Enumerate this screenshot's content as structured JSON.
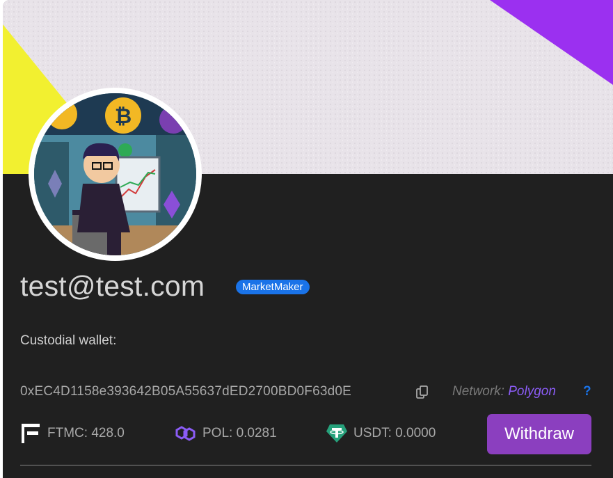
{
  "profile": {
    "username": "test@test.com",
    "role_badge": "MarketMaker",
    "avatar_icon": "pixel-art-trader-avatar"
  },
  "wallet": {
    "label": "Custodial wallet:",
    "address": "0xEC4D1158e393642B05A55637dED2700BD0F63d0E",
    "network_label": "Network:",
    "network_value": "Polygon",
    "help_symbol": "?"
  },
  "balances": [
    {
      "icon": "ftmc-logo-icon",
      "text": "FTMC: 428.0",
      "color": "#ffffff"
    },
    {
      "icon": "polygon-logo-icon",
      "text": "POL: 0.0281",
      "color": "#8b5cf6"
    },
    {
      "icon": "tether-logo-icon",
      "text": "USDT: 0.0000",
      "color": "#26a17b"
    }
  ],
  "actions": {
    "withdraw_label": "Withdraw"
  },
  "colors": {
    "card_background": "#202020",
    "badge_blue": "#1a73e8",
    "withdraw_purple": "#8b3fbf",
    "network_purple": "#8b5cf6",
    "banner_yellow": "#f2f030",
    "banner_purple": "#9b30f0"
  }
}
